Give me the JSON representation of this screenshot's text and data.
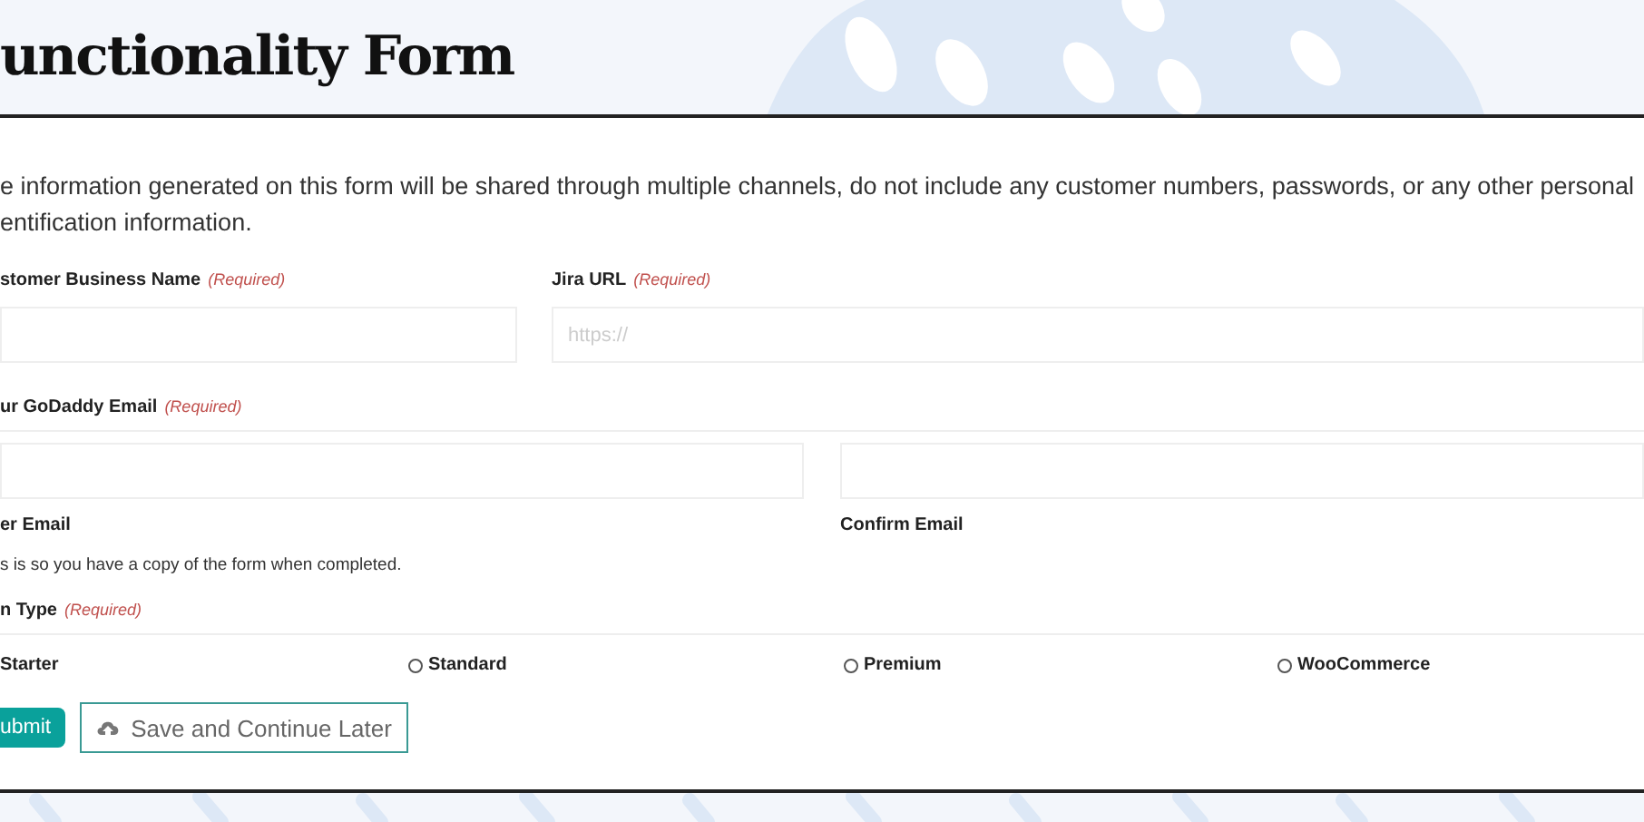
{
  "header": {
    "title": "unctionality Form"
  },
  "notice": "e information generated on this form will be shared through multiple channels, do not include any customer numbers, passwords, or any other personal\nentification information.",
  "fields": [
    {
      "label": "stomer Business Name",
      "required": "(Required)"
    },
    {
      "label": "Jira URL",
      "required": "(Required)",
      "placeholder": "https://"
    }
  ],
  "email": {
    "label": "ur GoDaddy Email",
    "required": "(Required)",
    "enter_label": "er Email",
    "confirm_label": "Confirm Email",
    "description": "s is so you have a copy of the form when completed."
  },
  "plan": {
    "label": "n Type",
    "required": "(Required)",
    "options": [
      {
        "label": "Starter"
      },
      {
        "label": "Standard",
        "selected": false
      },
      {
        "label": "Premium",
        "selected": false
      },
      {
        "label": "WooCommerce",
        "selected": false
      }
    ]
  },
  "buttons": {
    "submit": "ubmit",
    "save": "Save and Continue Later"
  }
}
